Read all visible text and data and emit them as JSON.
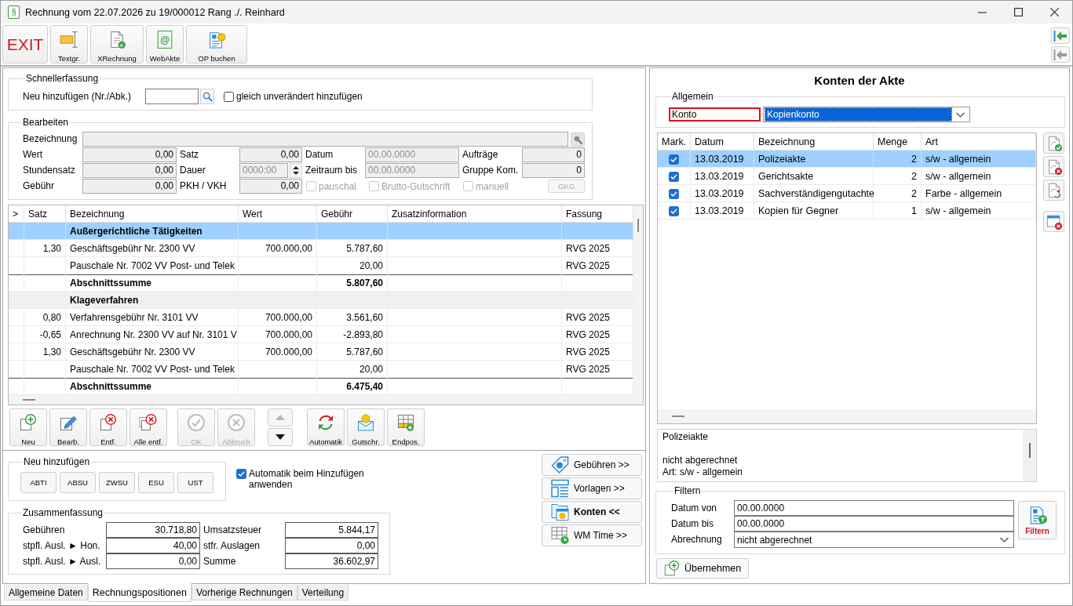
{
  "window": {
    "app_icon": "§",
    "title": "Rechnung vom 22.07.2026 zu 19/000012 Rang ./. Reinhard"
  },
  "toolbar": {
    "exit_button": {
      "label": "EXIT"
    },
    "buttons": [
      {
        "kind": "text-block",
        "label": "Textgr."
      },
      {
        "kind": "e-invoice",
        "label": "XRechnung"
      },
      {
        "kind": "web-file",
        "label": "WebAkte",
        "glyph": "@"
      },
      {
        "kind": "post-payment",
        "label": "OP buchen"
      }
    ],
    "side_buttons": [
      {
        "disabled": false
      },
      {
        "disabled": true
      }
    ]
  },
  "schnellerfassung": {
    "title": "Schnellerfassung",
    "label": "Neu hinzufügen (Nr./Abk.)",
    "checkbox": {
      "label": "gleich unverändert hinzufügen",
      "checked": false
    }
  },
  "bearbeiten": {
    "title": "Bearbeiten",
    "name_field": {
      "label": "Bezeichnung"
    },
    "fields": [
      {
        "label": "Wert",
        "value": "0,00",
        "kind": "number",
        "disabled": false
      },
      {
        "label": "Satz",
        "value": "0,00",
        "kind": "number",
        "disabled": false
      },
      {
        "label": "Datum",
        "value": "00.00.0000",
        "kind": "date",
        "disabled": true
      },
      {
        "label": "Aufträge",
        "value": "0",
        "kind": "number",
        "disabled": false
      },
      {
        "label": "Stundensatz",
        "value": "0,00",
        "kind": "number",
        "disabled": false
      },
      {
        "label": "Dauer",
        "value": "0000:00",
        "kind": "duration",
        "disabled": true
      },
      {
        "label": "Zeitraum bis",
        "value": "00.00.0000",
        "kind": "date",
        "disabled": true
      },
      {
        "label": "Gruppe Kom.",
        "value": "0",
        "kind": "number",
        "disabled": false
      },
      {
        "label": "Gebühr",
        "value": "0,00",
        "kind": "number",
        "disabled": false
      },
      {
        "label": "PKH / VKH",
        "value": "0,00",
        "kind": "number",
        "disabled": false
      }
    ],
    "checkboxes": [
      {
        "label": "pauschal",
        "checked": false,
        "disabled": true
      },
      {
        "label": "Brutto-Gutschrift",
        "checked": false,
        "disabled": true
      },
      {
        "label": "manuell",
        "checked": false,
        "disabled": true
      }
    ],
    "gkg_button": {
      "label": "GKG",
      "disabled": true
    }
  },
  "positions_table": {
    "columns": [
      ">",
      "Satz",
      "Bezeichnung",
      "Wert",
      "Gebühr",
      "Zusatzinformation",
      "Fassung"
    ],
    "rows": [
      {
        "kind": "group",
        "selected": true,
        "bezeichnung": "Außergerichtliche Tätigkeiten"
      },
      {
        "kind": "item",
        "selected": false,
        "satz": "1,30",
        "bezeichnung": "Geschäftsgebühr Nr. 2300 VV",
        "wert": "700.000,00",
        "gebuehr": "5.787,60",
        "fassung": "RVG 2025"
      },
      {
        "kind": "item",
        "selected": false,
        "bezeichnung": "Pauschale Nr. 7002 VV Post- und Telek",
        "gebuehr": "20,00",
        "fassung": "RVG 2025"
      },
      {
        "kind": "sum",
        "selected": false,
        "bezeichnung": "Abschnittssumme",
        "gebuehr": "5.807,60"
      },
      {
        "kind": "group",
        "selected": false,
        "bezeichnung": "Klageverfahren"
      },
      {
        "kind": "item",
        "selected": false,
        "satz": "0,80",
        "bezeichnung": "Verfahrensgebühr Nr. 3101 VV",
        "wert": "700.000,00",
        "gebuehr": "3.561,60",
        "fassung": "RVG 2025"
      },
      {
        "kind": "item",
        "selected": false,
        "satz": "-0,65",
        "bezeichnung": "Anrechnung Nr. 2300 VV auf Nr. 3101 V",
        "wert": "700.000,00",
        "gebuehr": "-2.893,80",
        "fassung": "RVG 2025"
      },
      {
        "kind": "item",
        "selected": false,
        "satz": "1,30",
        "bezeichnung": "Geschäftsgebühr Nr. 2300 VV",
        "wert": "700.000,00",
        "gebuehr": "5.787,60",
        "fassung": "RVG 2025"
      },
      {
        "kind": "item",
        "selected": false,
        "bezeichnung": "Pauschale Nr. 7002 VV Post- und Telek",
        "gebuehr": "20,00",
        "fassung": "RVG 2025"
      },
      {
        "kind": "sum",
        "selected": false,
        "bezeichnung": "Abschnittssumme",
        "gebuehr": "6.475,40"
      }
    ]
  },
  "edit_buttons": [
    {
      "kind": "new",
      "label": "Neu",
      "disabled": false
    },
    {
      "kind": "edit",
      "label": "Bearb.",
      "disabled": false
    },
    {
      "kind": "delete",
      "label": "Entf.",
      "disabled": false
    },
    {
      "kind": "delete-all",
      "label": "Alle entf.",
      "disabled": false
    }
  ],
  "confirm_buttons": [
    {
      "kind": "ok",
      "label": "OK",
      "disabled": true
    },
    {
      "kind": "cancel",
      "label": "Abbruch",
      "disabled": true
    }
  ],
  "move_buttons": [
    {
      "kind": "up",
      "disabled": true
    },
    {
      "kind": "down",
      "disabled": false
    }
  ],
  "tool_buttons": [
    {
      "kind": "recalculate",
      "label": "Automatik",
      "disabled": false
    },
    {
      "kind": "credit",
      "label": "Gutschr.",
      "disabled": false
    },
    {
      "kind": "end-position",
      "label": "Endpos.",
      "disabled": false
    }
  ],
  "neu_hinzufuegen": {
    "title": "Neu hinzufügen",
    "buttons": [
      "ABTI",
      "ABSU",
      "ZWSU",
      "ESU",
      "UST"
    ]
  },
  "auto_checkbox": {
    "label": "Automatik beim Hinzufügen anwenden",
    "checked": true
  },
  "zusammenfassung": {
    "title": "Zusammenfassung",
    "rows": [
      {
        "label": "Gebühren",
        "value": "30.718,80"
      },
      {
        "label": "Umsatzsteuer",
        "value": "5.844,17"
      },
      {
        "label": "stpfl. Ausl. ► Hon.",
        "value": "40,00"
      },
      {
        "label": "stfr. Auslagen",
        "value": "0,00"
      },
      {
        "label": "stpfl. Ausl. ► Ausl.",
        "value": "0,00"
      },
      {
        "label": "Summe",
        "value": "36.602,97"
      }
    ]
  },
  "nav_buttons": [
    {
      "kind": "fees",
      "label": "Gebühren >>",
      "selected": false
    },
    {
      "kind": "templates",
      "label": "Vorlagen >>",
      "selected": false
    },
    {
      "kind": "accounts",
      "label": "Konten <<",
      "selected": true
    },
    {
      "kind": "time",
      "label": "WM Time >>",
      "selected": false
    }
  ],
  "accounts_panel": {
    "title": "Konten der Akte",
    "allgemein": {
      "title": "Allgemein",
      "konto_label": {
        "text": "Konto",
        "highlighted": true
      },
      "konto_select": {
        "value": "Kopienkonto",
        "focused": true
      }
    },
    "table": {
      "columns": [
        "Mark.",
        "Datum",
        "Bezeichnung",
        "Menge",
        "Art"
      ],
      "rows": [
        {
          "checked": true,
          "selected": true,
          "datum": "13.03.2019",
          "bezeichnung": "Polizeiakte",
          "menge": "2",
          "art": "s/w - allgemein"
        },
        {
          "checked": true,
          "selected": false,
          "datum": "13.03.2019",
          "bezeichnung": "Gerichtsakte",
          "menge": "2",
          "art": "s/w - allgemein"
        },
        {
          "checked": true,
          "selected": false,
          "datum": "13.03.2019",
          "bezeichnung": "Sachverständigengutachte",
          "menge": "2",
          "art": "Farbe - allgemein"
        },
        {
          "checked": true,
          "selected": false,
          "datum": "13.03.2019",
          "bezeichnung": "Kopien für Gegner",
          "menge": "1",
          "art": "s/w - allgemein"
        }
      ]
    },
    "side_buttons": [
      {
        "kind": "accept"
      },
      {
        "kind": "reject"
      },
      {
        "kind": "refresh-document"
      },
      {
        "kind": "delete-window"
      }
    ],
    "detail": {
      "title": "Polizeiakte",
      "lines": [
        "nicht abgerechnet",
        "Art: s/w - allgemein"
      ]
    },
    "filter": {
      "title": "Filtern",
      "fields": [
        {
          "label": "Datum von",
          "value": "00.00.0000",
          "kind": "text"
        },
        {
          "label": "Datum bis",
          "value": "00.00.0000",
          "kind": "text"
        },
        {
          "label": "Abrechnung",
          "value": "nicht abgerechnet",
          "kind": "select"
        }
      ],
      "button": {
        "label": "Filtern"
      }
    },
    "apply_button": {
      "label": "Übernehmen"
    }
  },
  "tabs": [
    {
      "label": "Allgemeine Daten",
      "selected": false
    },
    {
      "label": "Rechnungspositionen",
      "selected": true
    },
    {
      "label": "Vorherige Rechnungen",
      "selected": false
    },
    {
      "label": "Verteilung",
      "selected": false
    }
  ]
}
